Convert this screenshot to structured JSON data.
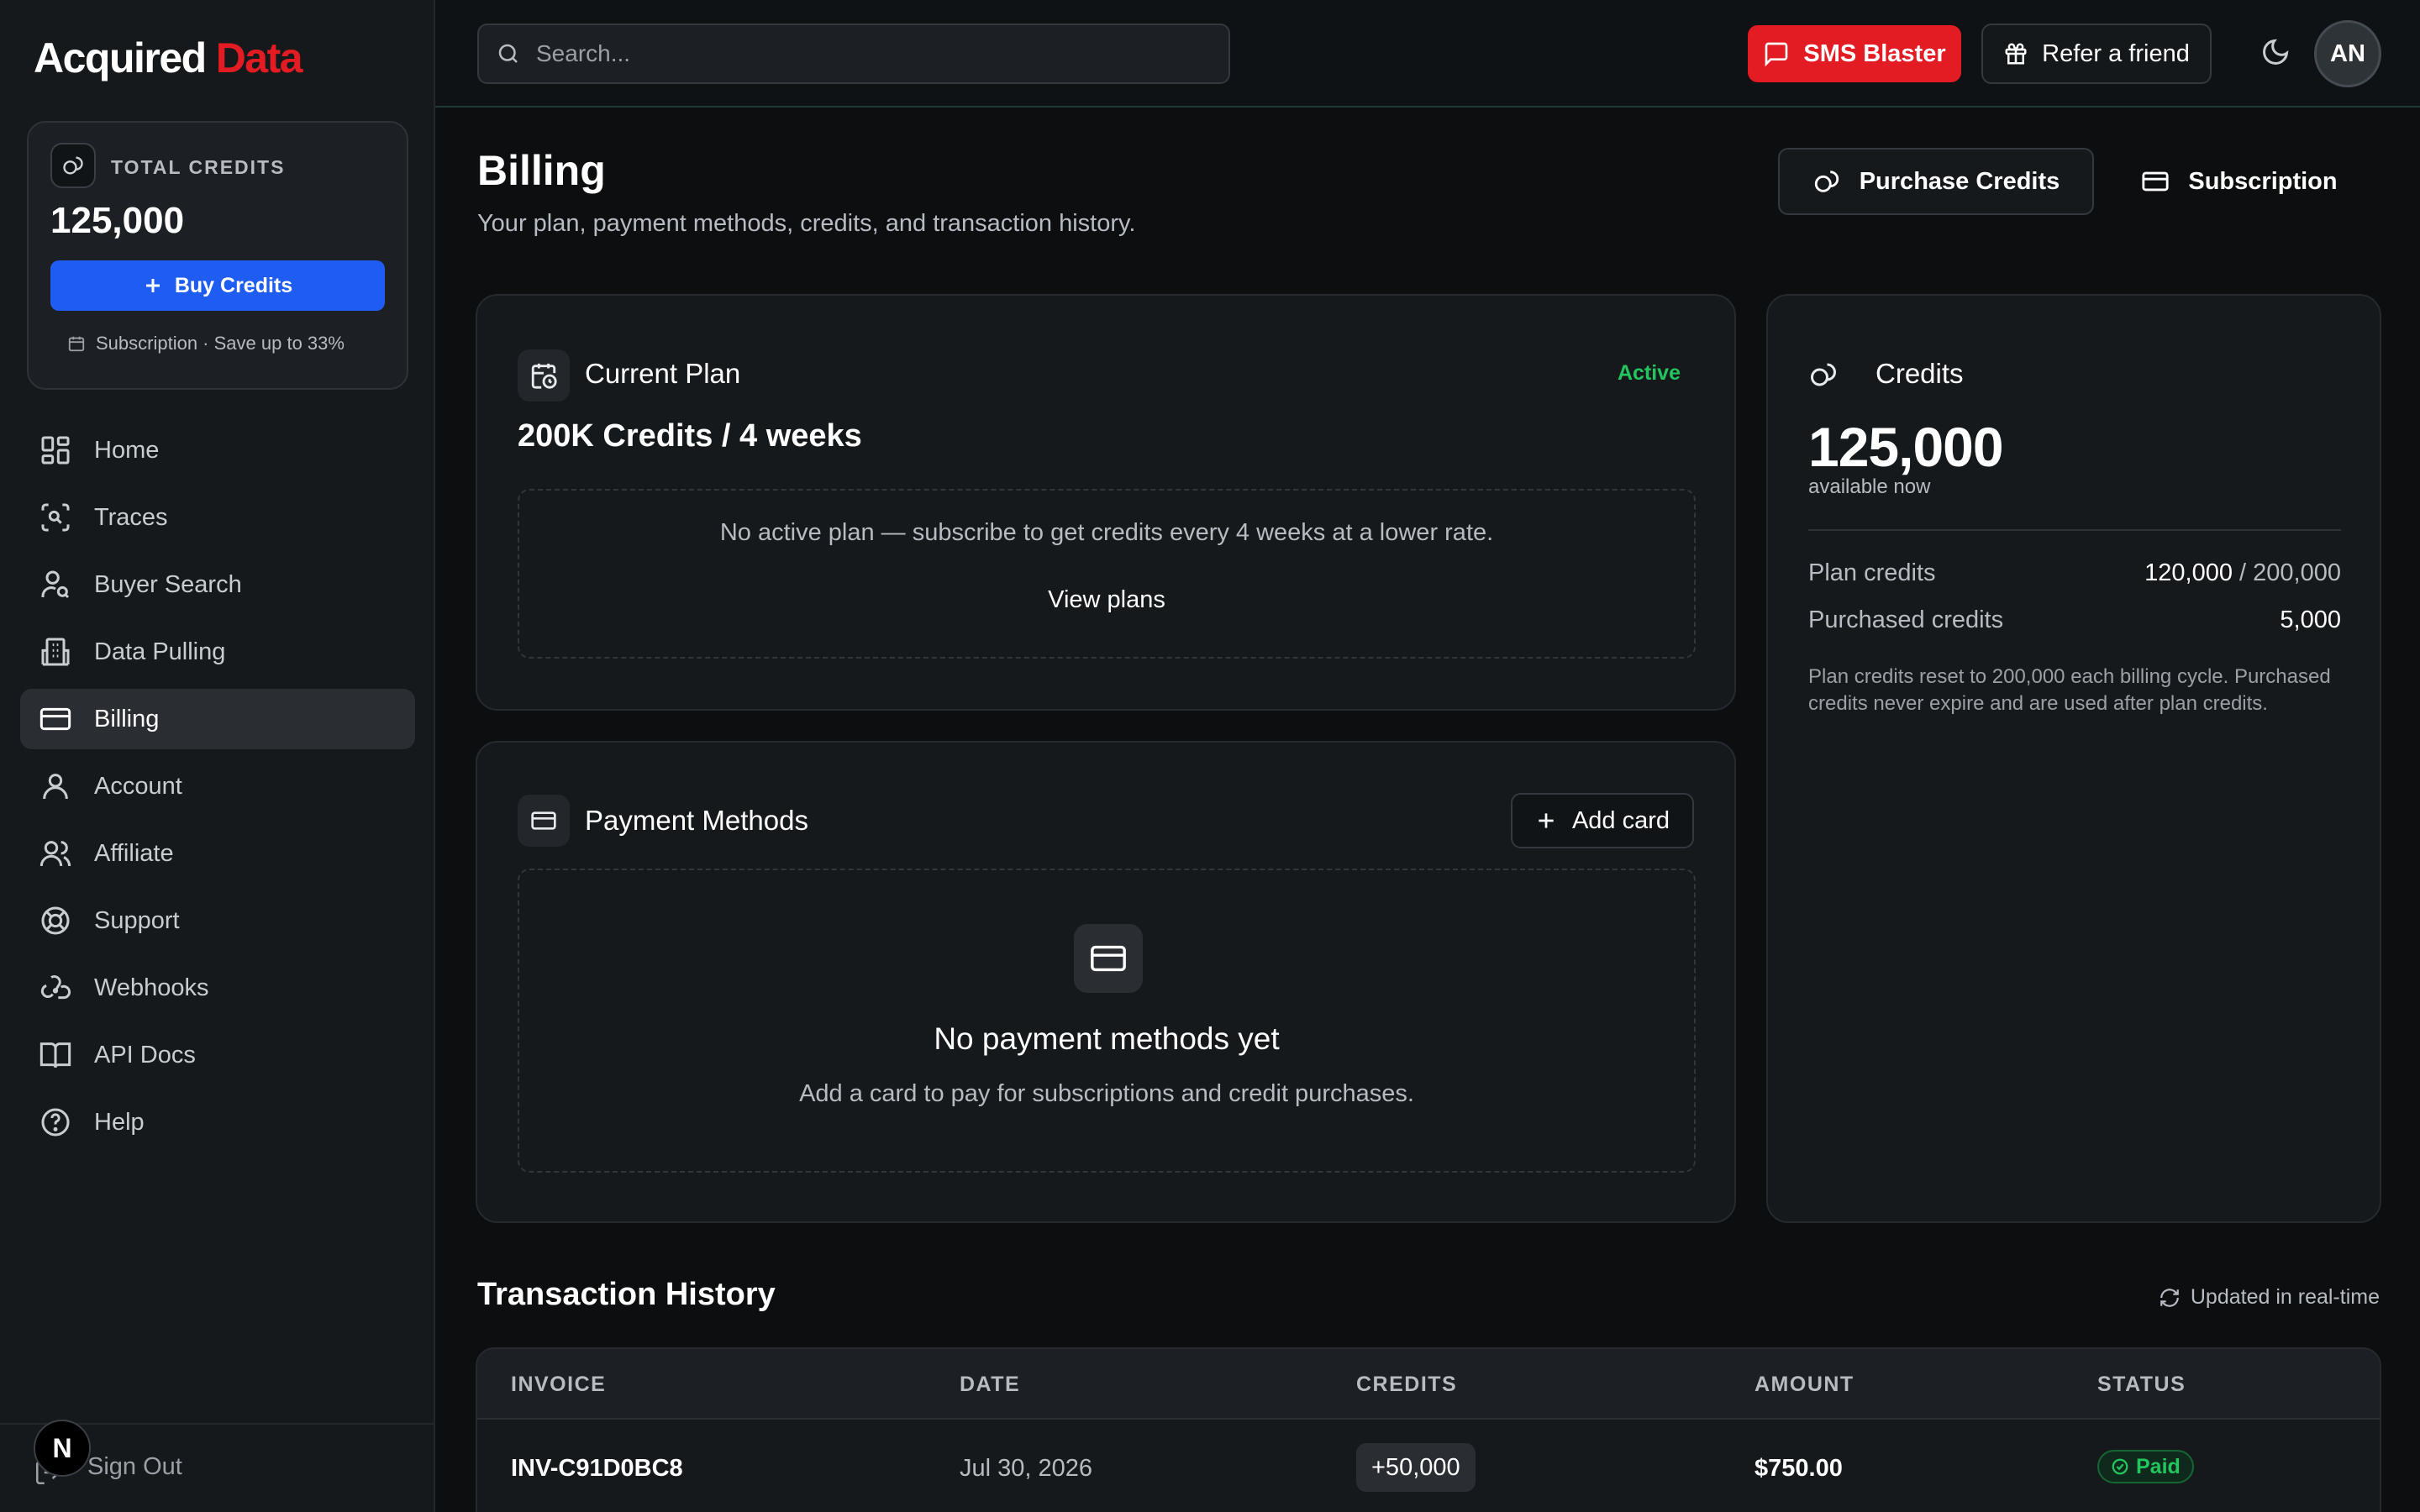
{
  "brand": {
    "name_primary": "Acquired",
    "name_accent": "Data",
    "accent_color": "#e31b23"
  },
  "sidebar": {
    "credits_card": {
      "label": "TOTAL CREDITS",
      "value": "125,000",
      "buy_label": "Buy Credits",
      "subscription_note": "Subscription · Save up to 33%"
    },
    "items": [
      {
        "label": "Home",
        "icon": "grid-icon"
      },
      {
        "label": "Traces",
        "icon": "scan-face-icon"
      },
      {
        "label": "Buyer Search",
        "icon": "user-search-icon"
      },
      {
        "label": "Data Pulling",
        "icon": "building-icon"
      },
      {
        "label": "Billing",
        "icon": "credit-card-icon",
        "active": true
      },
      {
        "label": "Account",
        "icon": "user-icon"
      },
      {
        "label": "Affiliate",
        "icon": "users-icon"
      },
      {
        "label": "Support",
        "icon": "life-buoy-icon"
      },
      {
        "label": "Webhooks",
        "icon": "webhook-icon"
      },
      {
        "label": "API Docs",
        "icon": "book-icon"
      },
      {
        "label": "Help",
        "icon": "help-circle-icon"
      }
    ],
    "sign_out_label": "Sign Out",
    "dev_badge": "N"
  },
  "topbar": {
    "search_placeholder": "Search...",
    "sms_label": "SMS Blaster",
    "refer_label": "Refer a friend",
    "avatar_initials": "AN"
  },
  "page": {
    "title": "Billing",
    "subtitle": "Your plan, payment methods, credits, and transaction history.",
    "purchase_label": "Purchase Credits",
    "subscription_label": "Subscription"
  },
  "current_plan": {
    "title": "Current Plan",
    "status": "Active",
    "plan_name": "200K Credits / 4 weeks",
    "message": "No active plan — subscribe to get credits every 4 weeks at a lower rate.",
    "view_plans_label": "View plans"
  },
  "payment_methods": {
    "title": "Payment Methods",
    "add_card_label": "Add card",
    "empty_title": "No payment methods yet",
    "empty_sub": "Add a card to pay for subscriptions and credit purchases."
  },
  "credits_panel": {
    "title": "Credits",
    "total": "125,000",
    "total_sub": "available now",
    "plan_label": "Plan credits",
    "plan_used": "120,000",
    "plan_total": "/ 200,000",
    "purchased_label": "Purchased credits",
    "purchased_value": "5,000",
    "note": "Plan credits reset to 200,000 each billing cycle. Purchased credits never expire and are used after plan credits."
  },
  "transactions": {
    "title": "Transaction History",
    "updated_label": "Updated in real-time",
    "columns": [
      "INVOICE",
      "DATE",
      "CREDITS",
      "AMOUNT",
      "STATUS"
    ],
    "rows": [
      {
        "invoice": "INV-C91D0BC8",
        "date": "Jul 30, 2026",
        "credits": "+50,000",
        "amount": "$750.00",
        "status": "Paid"
      }
    ]
  },
  "colors": {
    "primary_blue": "#1f5cf2",
    "success_green": "#22c55e",
    "background": "#0c0e10"
  }
}
